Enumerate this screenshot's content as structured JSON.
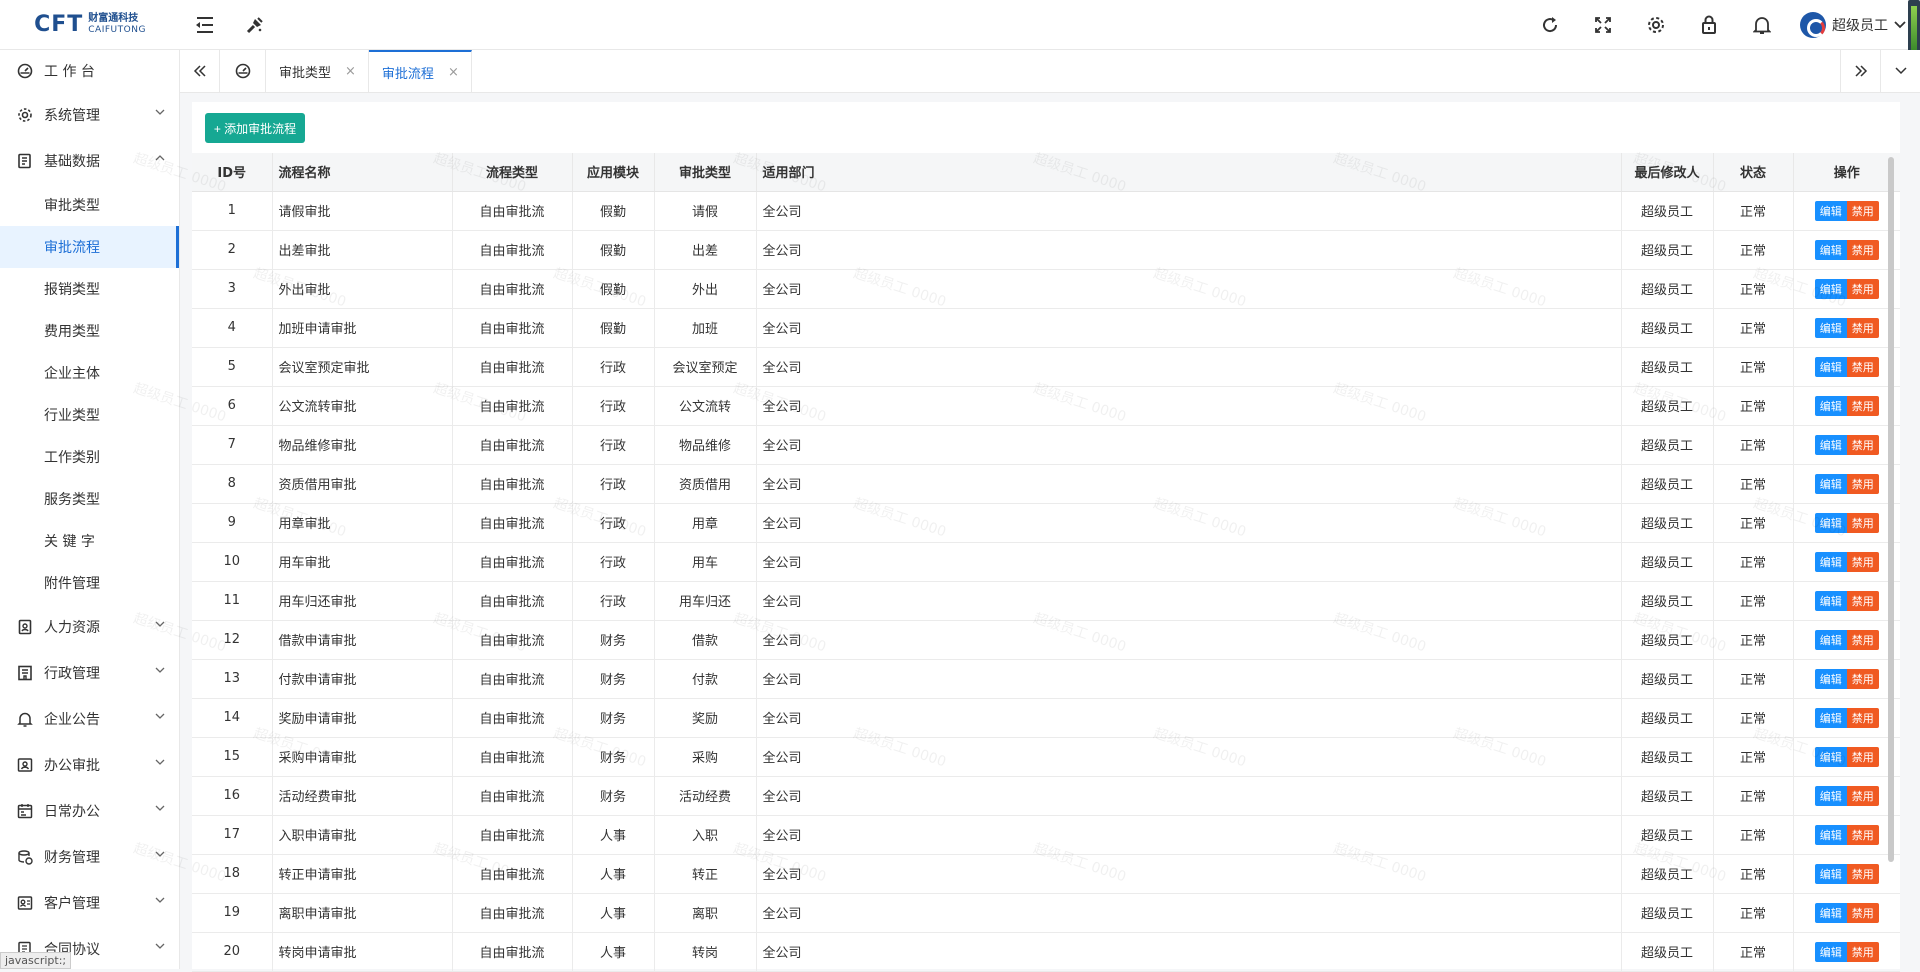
{
  "app": {
    "logo_mark": "CFT",
    "logo_cn": "财富通科技",
    "logo_en": "CAIFUTONG"
  },
  "header": {
    "user_name": "超级员工"
  },
  "sidebar": {
    "items": [
      {
        "label": "工 作 台",
        "icon": "dashboard-icon"
      },
      {
        "label": "系统管理",
        "icon": "gear-icon",
        "arrow": "chevron-down-icon"
      },
      {
        "label": "基础数据",
        "icon": "document-icon",
        "arrow": "chevron-up-icon"
      }
    ],
    "sub_items": [
      "审批类型",
      "审批流程",
      "报销类型",
      "费用类型",
      "企业主体",
      "行业类型",
      "工作类别",
      "服务类型",
      "关 键 字",
      "附件管理"
    ],
    "more_items": [
      {
        "label": "人力资源",
        "icon": "badge-icon"
      },
      {
        "label": "行政管理",
        "icon": "building-icon"
      },
      {
        "label": "企业公告",
        "icon": "bell-icon"
      },
      {
        "label": "办公审批",
        "icon": "approval-icon"
      },
      {
        "label": "日常办公",
        "icon": "calendar-icon"
      },
      {
        "label": "财务管理",
        "icon": "finance-icon"
      },
      {
        "label": "客户管理",
        "icon": "customer-icon"
      },
      {
        "label": "合同协议",
        "icon": "contract-icon"
      }
    ],
    "status_text": "javascript:;"
  },
  "tabs": [
    {
      "label": "审批类型",
      "close": "×"
    },
    {
      "label": "审批流程",
      "close": "×"
    }
  ],
  "toolbar": {
    "add_label": "+ 添加审批流程"
  },
  "table": {
    "headers": [
      "ID号",
      "流程名称",
      "流程类型",
      "应用模块",
      "审批类型",
      "适用部门",
      "最后修改人",
      "状态",
      "操作"
    ],
    "edit_label": "编辑",
    "disable_label": "禁用",
    "rows": [
      {
        "id": "1",
        "name": "请假审批",
        "type": "自由审批流",
        "module": "假勤",
        "approval": "请假",
        "dept": "全公司",
        "editor": "超级员工",
        "status": "正常"
      },
      {
        "id": "2",
        "name": "出差审批",
        "type": "自由审批流",
        "module": "假勤",
        "approval": "出差",
        "dept": "全公司",
        "editor": "超级员工",
        "status": "正常"
      },
      {
        "id": "3",
        "name": "外出审批",
        "type": "自由审批流",
        "module": "假勤",
        "approval": "外出",
        "dept": "全公司",
        "editor": "超级员工",
        "status": "正常"
      },
      {
        "id": "4",
        "name": "加班申请审批",
        "type": "自由审批流",
        "module": "假勤",
        "approval": "加班",
        "dept": "全公司",
        "editor": "超级员工",
        "status": "正常"
      },
      {
        "id": "5",
        "name": "会议室预定审批",
        "type": "自由审批流",
        "module": "行政",
        "approval": "会议室预定",
        "dept": "全公司",
        "editor": "超级员工",
        "status": "正常"
      },
      {
        "id": "6",
        "name": "公文流转审批",
        "type": "自由审批流",
        "module": "行政",
        "approval": "公文流转",
        "dept": "全公司",
        "editor": "超级员工",
        "status": "正常"
      },
      {
        "id": "7",
        "name": "物品维修审批",
        "type": "自由审批流",
        "module": "行政",
        "approval": "物品维修",
        "dept": "全公司",
        "editor": "超级员工",
        "status": "正常"
      },
      {
        "id": "8",
        "name": "资质借用审批",
        "type": "自由审批流",
        "module": "行政",
        "approval": "资质借用",
        "dept": "全公司",
        "editor": "超级员工",
        "status": "正常"
      },
      {
        "id": "9",
        "name": "用章审批",
        "type": "自由审批流",
        "module": "行政",
        "approval": "用章",
        "dept": "全公司",
        "editor": "超级员工",
        "status": "正常"
      },
      {
        "id": "10",
        "name": "用车审批",
        "type": "自由审批流",
        "module": "行政",
        "approval": "用车",
        "dept": "全公司",
        "editor": "超级员工",
        "status": "正常"
      },
      {
        "id": "11",
        "name": "用车归还审批",
        "type": "自由审批流",
        "module": "行政",
        "approval": "用车归还",
        "dept": "全公司",
        "editor": "超级员工",
        "status": "正常"
      },
      {
        "id": "12",
        "name": "借款申请审批",
        "type": "自由审批流",
        "module": "财务",
        "approval": "借款",
        "dept": "全公司",
        "editor": "超级员工",
        "status": "正常"
      },
      {
        "id": "13",
        "name": "付款申请审批",
        "type": "自由审批流",
        "module": "财务",
        "approval": "付款",
        "dept": "全公司",
        "editor": "超级员工",
        "status": "正常"
      },
      {
        "id": "14",
        "name": "奖励申请审批",
        "type": "自由审批流",
        "module": "财务",
        "approval": "奖励",
        "dept": "全公司",
        "editor": "超级员工",
        "status": "正常"
      },
      {
        "id": "15",
        "name": "采购申请审批",
        "type": "自由审批流",
        "module": "财务",
        "approval": "采购",
        "dept": "全公司",
        "editor": "超级员工",
        "status": "正常"
      },
      {
        "id": "16",
        "name": "活动经费审批",
        "type": "自由审批流",
        "module": "财务",
        "approval": "活动经费",
        "dept": "全公司",
        "editor": "超级员工",
        "status": "正常"
      },
      {
        "id": "17",
        "name": "入职申请审批",
        "type": "自由审批流",
        "module": "人事",
        "approval": "入职",
        "dept": "全公司",
        "editor": "超级员工",
        "status": "正常"
      },
      {
        "id": "18",
        "name": "转正申请审批",
        "type": "自由审批流",
        "module": "人事",
        "approval": "转正",
        "dept": "全公司",
        "editor": "超级员工",
        "status": "正常"
      },
      {
        "id": "19",
        "name": "离职申请审批",
        "type": "自由审批流",
        "module": "人事",
        "approval": "离职",
        "dept": "全公司",
        "editor": "超级员工",
        "status": "正常"
      },
      {
        "id": "20",
        "name": "转岗申请审批",
        "type": "自由审批流",
        "module": "人事",
        "approval": "转岗",
        "dept": "全公司",
        "editor": "超级员工",
        "status": "正常"
      }
    ]
  },
  "watermark": "超级员工 0000",
  "colors": {
    "primary": "#1d6fd6",
    "add_button": "#16a893",
    "edit_button": "#1890ff",
    "disable_button": "#f05a22",
    "status_ok": "#1aa35c"
  }
}
